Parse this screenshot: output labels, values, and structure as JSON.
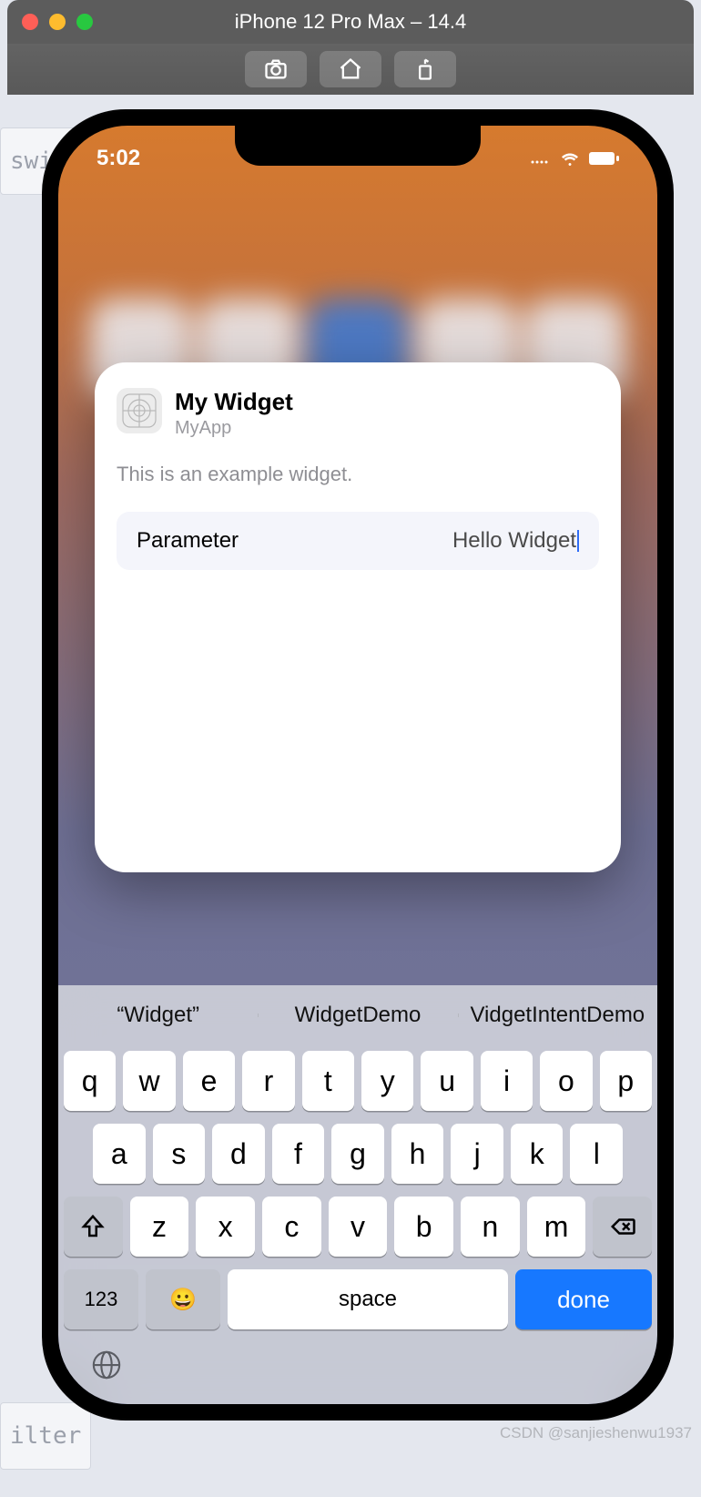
{
  "simulator": {
    "title": "iPhone 12 Pro Max – 14.4"
  },
  "statusbar": {
    "time": "5:02"
  },
  "widget_card": {
    "title": "My Widget",
    "app_name": "MyApp",
    "description": "This is an example widget.",
    "param_label": "Parameter",
    "param_value": "Hello Widget"
  },
  "keyboard": {
    "suggestions": [
      "“Widget”",
      "WidgetDemo",
      "VidgetIntentDemo"
    ],
    "row1": [
      "q",
      "w",
      "e",
      "r",
      "t",
      "y",
      "u",
      "i",
      "o",
      "p"
    ],
    "row2": [
      "a",
      "s",
      "d",
      "f",
      "g",
      "h",
      "j",
      "k",
      "l"
    ],
    "row3": [
      "z",
      "x",
      "c",
      "v",
      "b",
      "n",
      "m"
    ],
    "numeric_label": "123",
    "space_label": "space",
    "done_label": "done"
  },
  "bg_tags": {
    "swift": "swift",
    "ilter": "ilter"
  },
  "watermark": "CSDN @sanjieshenwu1937"
}
